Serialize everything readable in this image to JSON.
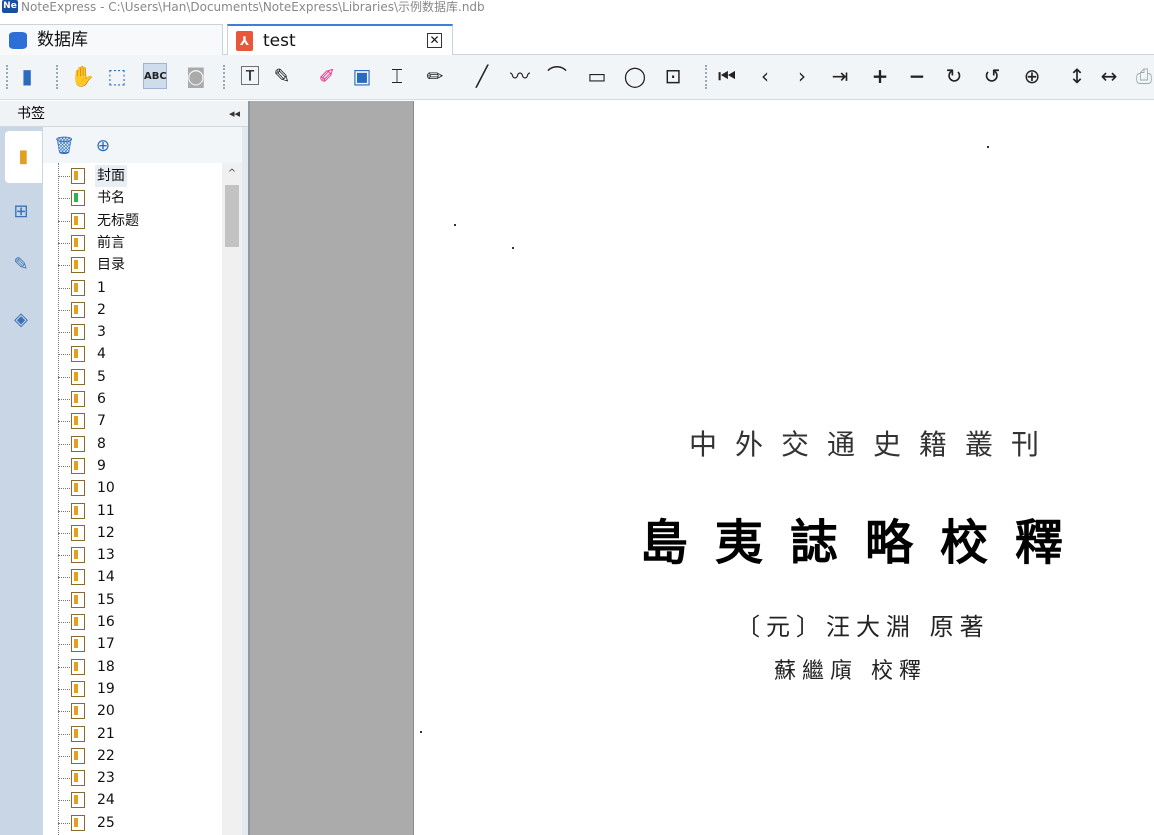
{
  "window": {
    "title": "NoteExpress - C:\\Users\\Han\\Documents\\NoteExpress\\Libraries\\示例数据库.ndb",
    "app_icon": "Ne"
  },
  "tabs": [
    {
      "label": "数据库",
      "icon": "database-icon"
    },
    {
      "label": "test",
      "icon": "pdf-icon",
      "close": "✕"
    }
  ],
  "toolbar": {
    "icons": [
      "page-icon",
      "hand-tool-icon",
      "select-area-icon",
      "text-select-icon",
      "snapshot-icon",
      "text-box-icon",
      "note-edit-icon",
      "highlighter-icon",
      "area-highlight-icon",
      "text-insert-icon",
      "pencil-icon",
      "line-icon",
      "freehand-icon",
      "arc-icon",
      "rectangle-icon",
      "ellipse-icon",
      "image-icon",
      "first-page-icon",
      "prev-page-icon",
      "next-page-icon",
      "last-page-icon",
      "zoom-in-icon",
      "zoom-out-icon",
      "rotate-cw-icon",
      "rotate-ccw-icon",
      "zoom-tool-icon",
      "fit-height-icon",
      "fit-width-icon",
      "print-icon"
    ]
  },
  "sidebar": {
    "title": "书签",
    "collapse": "◂◂",
    "rail": [
      "bookmark-panel-icon",
      "thumbnail-panel-icon",
      "annotation-panel-icon",
      "layers-panel-icon"
    ],
    "tools": [
      "delete-bookmark-icon",
      "add-bookmark-icon"
    ],
    "bookmarks": [
      "封面",
      "书名",
      "无标题",
      "前言",
      "目录",
      "1",
      "2",
      "3",
      "4",
      "5",
      "6",
      "7",
      "8",
      "9",
      "10",
      "11",
      "12",
      "13",
      "14",
      "15",
      "16",
      "17",
      "18",
      "19",
      "20",
      "21",
      "22",
      "23",
      "24",
      "25"
    ]
  },
  "document": {
    "series": "中外交通史籍叢刊",
    "title": "島夷誌略校釋",
    "author_line1": "〔元〕汪大淵 原著",
    "author_line2": "蘇繼廎 校釋"
  }
}
